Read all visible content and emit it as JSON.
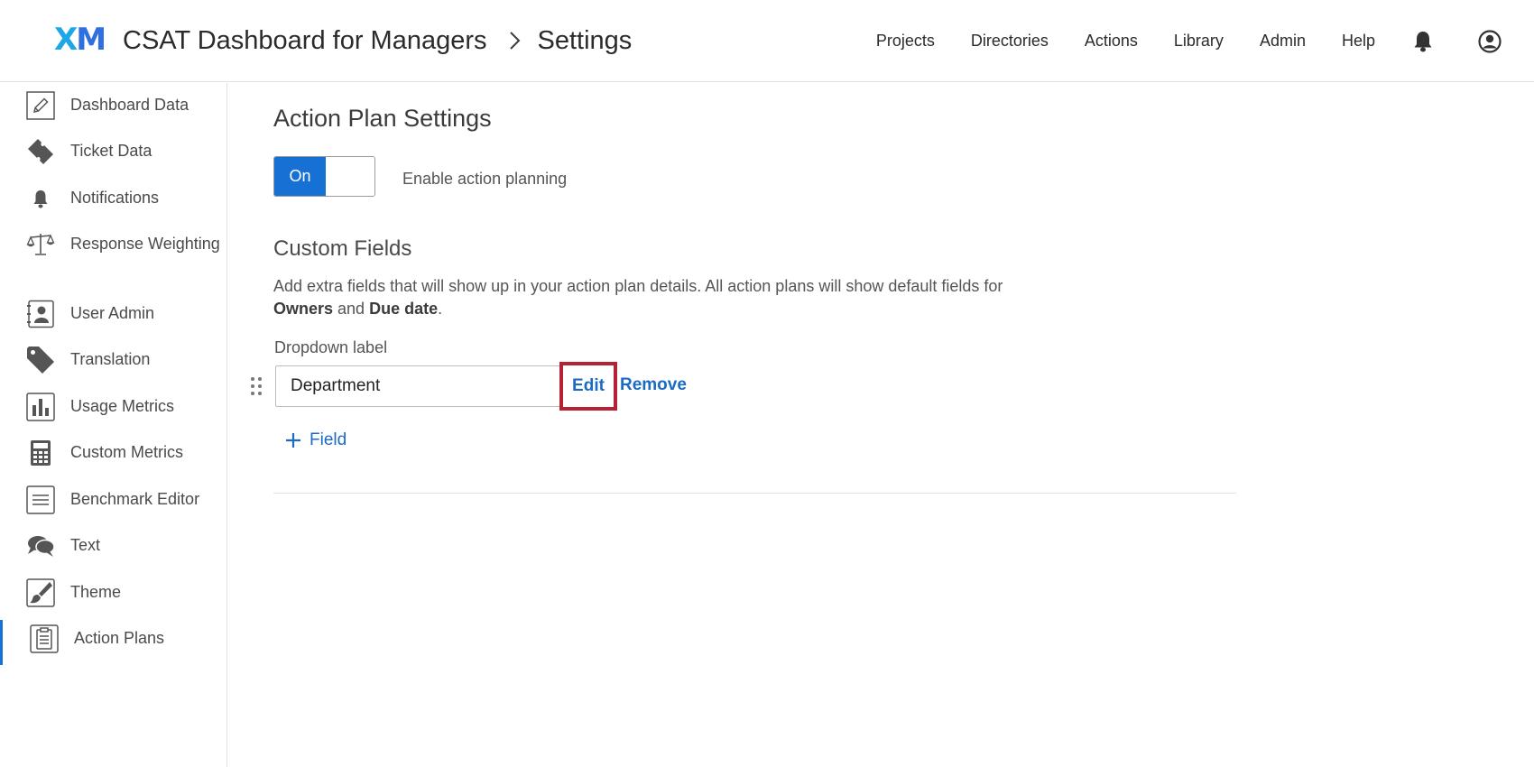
{
  "header": {
    "logo_x": "X",
    "logo_m": "M",
    "project_title": "CSAT Dashboard for Managers",
    "page_title": "Settings",
    "nav": [
      "Projects",
      "Directories",
      "Actions",
      "Library",
      "Admin",
      "Help"
    ]
  },
  "sidebar": {
    "items": [
      {
        "label": "Dashboard Data",
        "icon": "pencil-icon"
      },
      {
        "label": "Ticket Data",
        "icon": "ticket-icon"
      },
      {
        "label": "Notifications",
        "icon": "bell-icon"
      },
      {
        "label": "Response Weighting",
        "icon": "scale-icon"
      },
      {
        "label": "User Admin",
        "icon": "user-card-icon"
      },
      {
        "label": "Translation",
        "icon": "tag-icon"
      },
      {
        "label": "Usage Metrics",
        "icon": "bar-chart-icon"
      },
      {
        "label": "Custom Metrics",
        "icon": "calculator-icon"
      },
      {
        "label": "Benchmark Editor",
        "icon": "list-icon"
      },
      {
        "label": "Text",
        "icon": "chat-bubbles-icon"
      },
      {
        "label": "Theme",
        "icon": "paintbrush-icon"
      },
      {
        "label": "Action Plans",
        "icon": "clipboard-icon"
      }
    ],
    "active_index": 11
  },
  "main": {
    "title": "Action Plan Settings",
    "toggle": {
      "on_label": "On",
      "state": "on",
      "description": "Enable action planning"
    },
    "custom_fields": {
      "title": "Custom Fields",
      "description_prefix": "Add extra fields that will show up in your action plan details. All action plans will show default fields for",
      "owners": "Owners",
      "and": " and ",
      "due_date": "Due date",
      "period": ".",
      "dropdown_label": "Dropdown label",
      "field_value": "Department",
      "edit_label": "Edit",
      "remove_label": "Remove",
      "add_field_label": "Field"
    }
  },
  "colors": {
    "accent": "#1770d4",
    "link": "#1b6bc4",
    "highlight_border": "#b52234",
    "logo_x": "#1ea7e6",
    "logo_m": "#2f6fe0"
  }
}
